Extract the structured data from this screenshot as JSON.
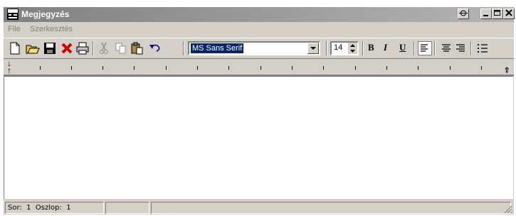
{
  "window": {
    "title": "Megjegyzés"
  },
  "menu": {
    "items": [
      "File",
      "Szerkesztés"
    ]
  },
  "toolbar": {
    "font_name": "MS Sans Serif",
    "font_size": "14",
    "bold_label": "B",
    "italic_label": "I",
    "underline_label": "U",
    "icons": [
      "new-document",
      "open-folder",
      "save",
      "delete",
      "print",
      "cut",
      "copy",
      "paste",
      "undo",
      "align-left",
      "align-center",
      "align-right",
      "bullet-list"
    ]
  },
  "status": {
    "row_label": "Sor:",
    "row_value": "1",
    "col_label": "Oszlop:",
    "col_value": "1"
  },
  "colors": {
    "titlebar_start": "#808080",
    "titlebar_end": "#b4b4b4",
    "selection": "#0a246a",
    "delete_red": "#cc0000"
  }
}
